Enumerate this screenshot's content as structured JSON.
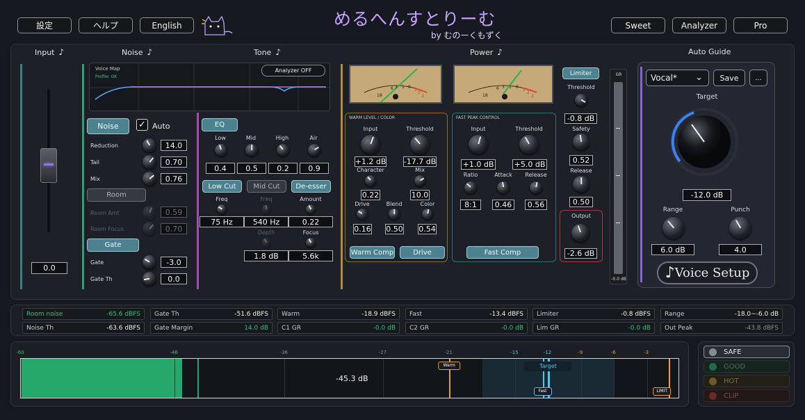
{
  "header": {
    "settings_label": "設定",
    "help_label": "ヘルプ",
    "language_label": "English",
    "logo_text": "めるへんすとりーむ",
    "logo_byline": "by むのーくもずく",
    "preset_sweet": "Sweet",
    "preset_analyzer": "Analyzer",
    "preset_pro": "Pro"
  },
  "sections": {
    "input": "Input",
    "noise": "Noise",
    "tone": "Tone",
    "power": "Power",
    "auto_guide": "Auto Guide",
    "note_glyph": "♪"
  },
  "input": {
    "value": "0.0"
  },
  "voice_map": {
    "title": "Voice Map",
    "profile": "Profile: OK",
    "analyzer_button": "Analyzer OFF"
  },
  "noise": {
    "noise_button": "Noise",
    "auto_label": "Auto",
    "auto_checked": true,
    "reduction_label": "Reduction",
    "reduction": "14.0",
    "tail_label": "Tail",
    "tail": "0.70",
    "mix_label": "Mix",
    "mix": "0.76",
    "room_button": "Room",
    "room_amt_label": "Room Amt",
    "room_amt": "0.59",
    "room_focus_label": "Room Focus",
    "room_focus": "0.70",
    "gate_button": "Gate",
    "gate_label": "Gate",
    "gate": "-3.0",
    "gate_th_label": "Gate Th",
    "gate_th": "0.0"
  },
  "tone": {
    "eq_button": "EQ",
    "low_label": "Low",
    "low": "0.4",
    "mid_label": "Mid",
    "mid": "0.5",
    "high_label": "High",
    "high": "0.2",
    "air_label": "Air",
    "air": "0.9",
    "lowcut_button": "Low Cut",
    "midcut_button": "Mid Cut",
    "deesser_button": "De-esser",
    "freq1_label": "Freq",
    "freq1": "75 Hz",
    "freq2_label": "Freq",
    "freq2": "540 Hz",
    "amount_label": "Amount",
    "amount": "0.22",
    "depth_label": "Depth",
    "depth": "1.8 dB",
    "focus_label": "Focus",
    "focus": "5.6k"
  },
  "warm": {
    "title": "WARM LEVEL / COLOR",
    "input_label": "Input",
    "input": "+1.2 dB",
    "threshold_label": "Threshold",
    "threshold": "-17.7 dB",
    "character_label": "Character",
    "character": "0.22",
    "mix_label": "Mix",
    "mix": "10.0",
    "drive_label": "Drive",
    "drive": "0.16",
    "blend_label": "Blend",
    "blend": "0.50",
    "color_label": "Color",
    "color": "0.54",
    "warm_comp_button": "Warm Comp",
    "drive_button": "Drive",
    "vu_ticks": [
      "18",
      "6",
      "3",
      "1",
      "0",
      "1",
      "2",
      "3"
    ]
  },
  "fast": {
    "title": "FAST PEAK CONTROL",
    "input_label": "Input",
    "input": "+1.0 dB",
    "threshold_label": "Threshold",
    "threshold": "+5.0 dB",
    "ratio_label": "Ratio",
    "ratio": "8:1",
    "attack_label": "Attack",
    "attack": "0.46",
    "release_label": "Release",
    "release": "0.56",
    "fast_comp_button": "Fast Comp",
    "vu_ticks": [
      "18",
      "6",
      "3",
      "1",
      "0",
      "1",
      "2",
      "3"
    ]
  },
  "limiter": {
    "button": "Limiter",
    "threshold_label": "Threshold",
    "threshold": "-0.8 dB",
    "safety_label": "Safety",
    "safety": "0.52",
    "release_label": "Release",
    "release": "0.50",
    "output_label": "Output",
    "output": "-2.6 dB",
    "gr_label": "GR",
    "gr_value": "-0.0 dB"
  },
  "auto_guide": {
    "preset": "Vocal*",
    "save_button": "Save",
    "more_button": "...",
    "target_label": "Target",
    "target": "-12.0 dB",
    "range_label": "Range",
    "range": "6.0 dB",
    "punch_label": "Punch",
    "punch": "4.0",
    "voice_setup_button": "Voice Setup"
  },
  "stats": {
    "room_noise": {
      "label": "Room noise",
      "value": "-65.6 dBFS"
    },
    "noise_th": {
      "label": "Noise Th",
      "value": "-63.6 dBFS"
    },
    "gate_th": {
      "label": "Gate Th",
      "value": "-51.6 dBFS"
    },
    "gate_margin": {
      "label": "Gate Margin",
      "value": "14.0 dB"
    },
    "warm": {
      "label": "Warm",
      "value": "-18.9 dBFS"
    },
    "c1_gr": {
      "label": "C1 GR",
      "value": "-0.0 dB"
    },
    "fast": {
      "label": "Fast",
      "value": "-13.4 dBFS"
    },
    "c2_gr": {
      "label": "C2 GR",
      "value": "-0.0 dB"
    },
    "limiter": {
      "label": "Limiter",
      "value": "-0.8 dBFS"
    },
    "lim_gr": {
      "label": "Lim GR",
      "value": "-0.0 dB"
    },
    "range": {
      "label": "Range",
      "value": "-18.0~-6.0 dB"
    },
    "out_peak": {
      "label": "Out Peak",
      "value": "-43.8 dBFS"
    }
  },
  "meter": {
    "ticks": [
      "-60",
      "-46",
      "-36",
      "-27",
      "-21",
      "-15",
      "-12",
      "-9",
      "-6",
      "-3"
    ],
    "scale_min": -60,
    "scale_max": 0,
    "level": -45.3,
    "readout": "-45.3 dB",
    "warm_marker": "Warm",
    "target_marker": "Target",
    "fast_marker": "Fast",
    "limit_marker": "LIMIT",
    "colors": {
      "level": "#26a86a",
      "target": "#4fc3f7",
      "warm": "#e0a040",
      "limit": "#f0a040"
    }
  },
  "status": {
    "safe": "SAFE",
    "good": "GOOD",
    "hot": "HOT",
    "clip": "CLIP",
    "colors": {
      "safe": "#888c93",
      "good": "#1f6b4c",
      "hot": "#6b5a2a",
      "clip": "#6b2a2a"
    }
  }
}
